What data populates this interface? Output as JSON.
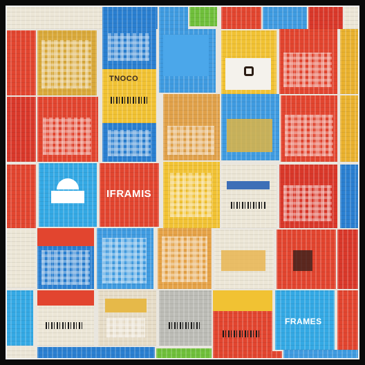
{
  "image": {
    "description_role": "collage-of-colorful-box-tiles",
    "tiles": [
      {
        "id": "t-r1-a",
        "color": "red"
      },
      {
        "id": "t-r1-b",
        "color": "blue"
      },
      {
        "id": "t-r1-c",
        "color": "yellow"
      },
      {
        "id": "t-r1-d",
        "color": "red"
      },
      {
        "id": "t-r1-e",
        "color": "blue"
      },
      {
        "id": "t-r1-f",
        "color": "red"
      }
    ]
  },
  "signs": {
    "sign_a": "TNOCO",
    "sign_b": "IFRAMIS",
    "sign_c": "FRAMES"
  },
  "colors": {
    "red": "#e2452f",
    "blue": "#2a7fd0",
    "yellow": "#f1c233",
    "cream": "#ece6d6",
    "frame": "#0a0a0a"
  }
}
